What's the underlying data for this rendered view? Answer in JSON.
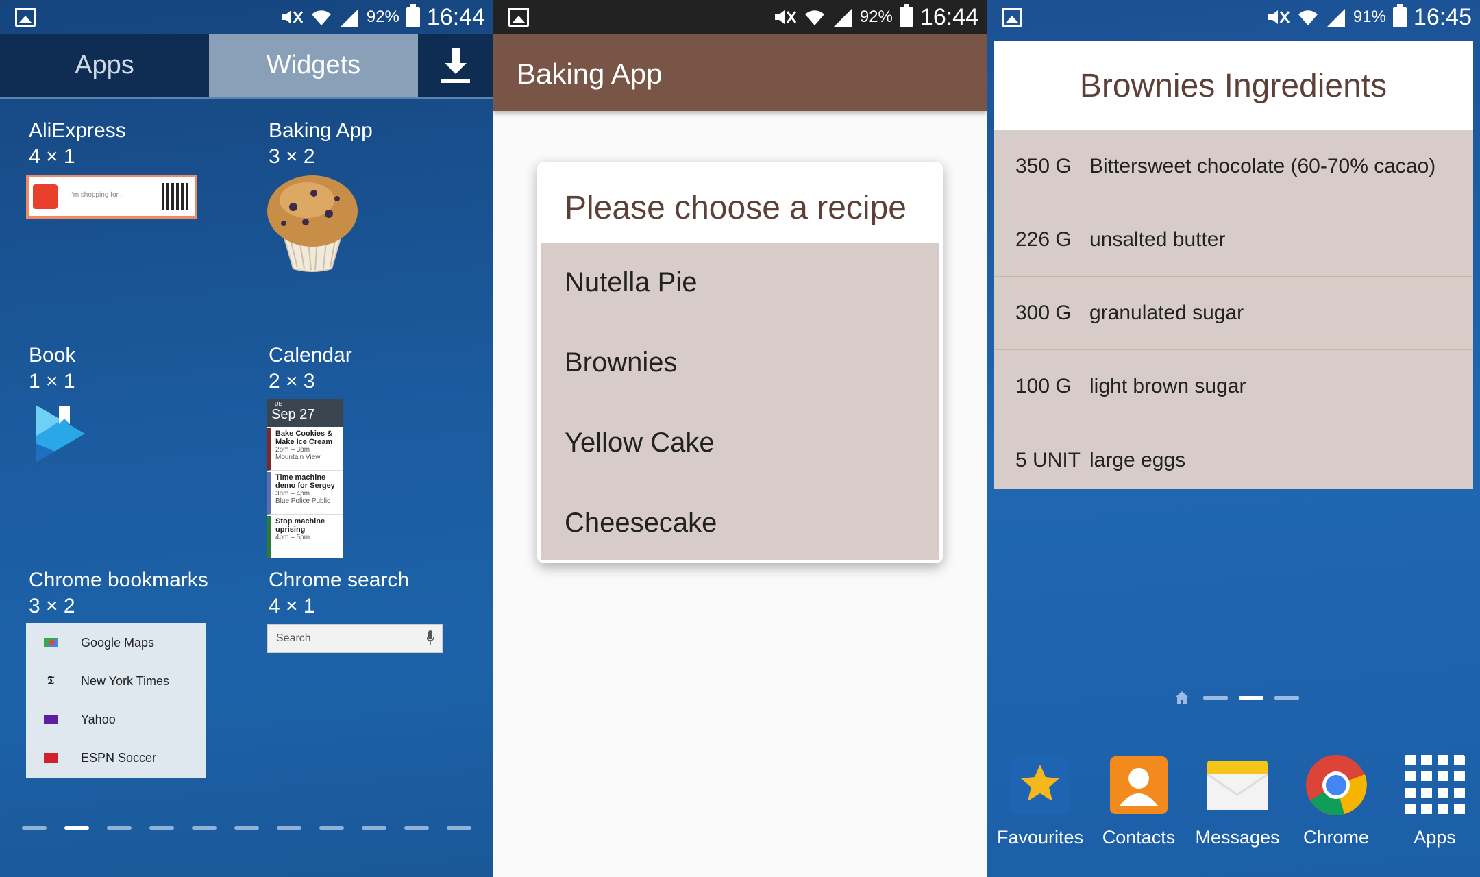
{
  "status_bars": [
    {
      "battery": "92%",
      "time": "16:44"
    },
    {
      "battery": "92%",
      "time": "16:44"
    },
    {
      "battery": "91%",
      "time": "16:45"
    }
  ],
  "widget_picker": {
    "tabs": {
      "apps": "Apps",
      "widgets": "Widgets"
    },
    "widgets": [
      {
        "name": "AliExpress",
        "size": "4 × 1",
        "preview_text": "I'm shopping for..."
      },
      {
        "name": "Baking App",
        "size": "3 × 2"
      },
      {
        "name": "Book",
        "size": "1 × 1"
      },
      {
        "name": "Calendar",
        "size": "2 × 3"
      },
      {
        "name": "Chrome bookmarks",
        "size": "3 × 2"
      },
      {
        "name": "Chrome search",
        "size": "4 × 1"
      }
    ],
    "calendar_preview": {
      "day": "TUE",
      "date": "Sep 27",
      "events": [
        {
          "title": "Bake Cookies & Make Ice Cream",
          "time": "2pm – 3pm",
          "place": "Mountain View"
        },
        {
          "title": "Time machine demo for Sergey",
          "time": "3pm – 4pm",
          "place": "Blue Police Public"
        },
        {
          "title": "Stop machine uprising",
          "time": "4pm – 5pm",
          "place": ""
        }
      ]
    },
    "bookmarks": [
      "Google Maps",
      "New York Times",
      "Yahoo",
      "ESPN Soccer"
    ],
    "search_placeholder": "Search",
    "page_count": 11,
    "active_page": 2
  },
  "baking_app": {
    "title": "Baking App",
    "prompt": "Please choose a recipe",
    "recipes": [
      "Nutella Pie",
      "Brownies",
      "Yellow Cake",
      "Cheesecake"
    ]
  },
  "ingredients_widget": {
    "title": "Brownies Ingredients",
    "items": [
      {
        "qty": "350 G",
        "name": "Bittersweet chocolate (60-70% cacao)"
      },
      {
        "qty": "226 G",
        "name": "unsalted butter"
      },
      {
        "qty": "300 G",
        "name": "granulated sugar"
      },
      {
        "qty": "100 G",
        "name": "light brown sugar"
      },
      {
        "qty": "5 UNIT",
        "name": "large eggs"
      }
    ]
  },
  "dock": [
    {
      "label": "Favourites",
      "icon": "star-icon",
      "color": "#1f63b3"
    },
    {
      "label": "Contacts",
      "icon": "contact-icon",
      "color": "#f28a1e"
    },
    {
      "label": "Messages",
      "icon": "envelope-icon",
      "color": "#f5c518"
    },
    {
      "label": "Chrome",
      "icon": "chrome-icon",
      "color": "#db4437"
    },
    {
      "label": "Apps",
      "icon": "app-grid-icon",
      "color": "#ffffff"
    }
  ],
  "colors": {
    "brown_primary": "#795548",
    "brown_light": "#d7ccc8",
    "title_brown": "#5d4037"
  }
}
